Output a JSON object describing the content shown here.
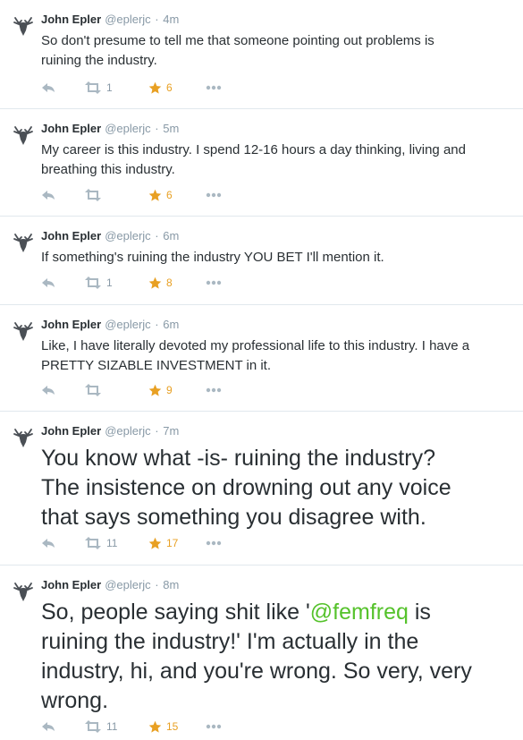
{
  "tweets": [
    {
      "name": "John Epler",
      "handle": "@eplerjc",
      "time": "4m",
      "lines": [
        "So don't presume to tell me that someone pointing out problems is",
        "ruining the industry."
      ],
      "retweets": "1",
      "favorites": "6"
    },
    {
      "name": "John Epler",
      "handle": "@eplerjc",
      "time": "5m",
      "lines": [
        "My career is this industry. I spend 12-16 hours a day thinking, living and",
        "breathing this industry."
      ],
      "retweets": "",
      "favorites": "6"
    },
    {
      "name": "John Epler",
      "handle": "@eplerjc",
      "time": "6m",
      "lines": [
        "If something's ruining the industry YOU BET I'll mention it."
      ],
      "retweets": "1",
      "favorites": "8"
    },
    {
      "name": "John Epler",
      "handle": "@eplerjc",
      "time": "6m",
      "lines": [
        "Like, I have literally devoted my professional life to this industry. I have a",
        "PRETTY SIZABLE INVESTMENT in it."
      ],
      "retweets": "",
      "favorites": "9"
    },
    {
      "name": "John Epler",
      "handle": "@eplerjc",
      "time": "7m",
      "lines": [
        "You know what -is- ruining the industry?",
        "The insistence on drowning out any voice",
        "that says something you disagree with."
      ],
      "retweets": "11",
      "favorites": "17"
    },
    {
      "name": "John Epler",
      "handle": "@eplerjc",
      "time": "8m",
      "line1_pre": "So, people saying shit like '",
      "mention": "@femfreq",
      "line1_post": " is",
      "lines": [
        "ruining the industry!' I'm actually in the",
        "industry, hi, and you're wrong. So very, very",
        "wrong."
      ],
      "retweets": "11",
      "favorites": "15"
    }
  ],
  "colors": {
    "name": "#292f33",
    "meta": "#8899a6",
    "favorite": "#e8a023",
    "mention": "#55c22b",
    "divider": "#e1e8ed"
  },
  "icons": {
    "avatar": "deer-skull-avatar",
    "reply": "reply-icon",
    "retweet": "retweet-icon",
    "favorite": "star-icon",
    "more": "more-dots-icon"
  }
}
